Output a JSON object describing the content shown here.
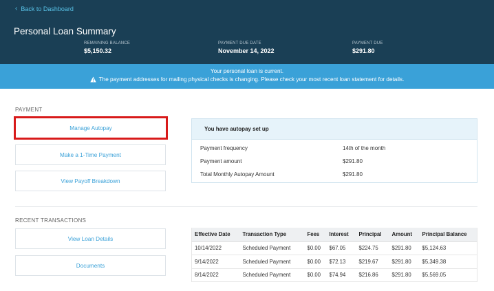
{
  "header": {
    "back_label": "Back to Dashboard",
    "title": "Personal Loan Summary",
    "stats": [
      {
        "label": "REMAINING BALANCE",
        "value": "$5,150.32"
      },
      {
        "label": "PAYMENT DUE DATE",
        "value": "November 14, 2022"
      },
      {
        "label": "PAYMENT DUE",
        "value": "$291.80"
      }
    ]
  },
  "banner": {
    "line1": "Your personal loan is current.",
    "line2": "The payment addresses for mailing physical checks is changing. Please check your most recent loan statement for details."
  },
  "payment": {
    "section_label": "PAYMENT",
    "buttons": [
      "Manage Autopay",
      "Make a 1-Time Payment",
      "View Payoff Breakdown"
    ]
  },
  "autopay": {
    "heading": "You have autopay set up",
    "rows": [
      {
        "label": "Payment frequency",
        "value": "14th of the month"
      },
      {
        "label": "Payment amount",
        "value": "$291.80"
      },
      {
        "label": "Total Monthly Autopay Amount",
        "value": "$291.80"
      }
    ]
  },
  "transactions": {
    "section_label": "RECENT TRANSACTIONS",
    "buttons": [
      "View Loan Details",
      "Documents"
    ],
    "columns": [
      "Effective Date",
      "Transaction Type",
      "Fees",
      "Interest",
      "Principal",
      "Amount",
      "Principal Balance"
    ],
    "rows": [
      [
        "10/14/2022",
        "Scheduled Payment",
        "$0.00",
        "$67.05",
        "$224.75",
        "$291.80",
        "$5,124.63"
      ],
      [
        "9/14/2022",
        "Scheduled Payment",
        "$0.00",
        "$72.13",
        "$219.67",
        "$291.80",
        "$5,349.38"
      ],
      [
        "8/14/2022",
        "Scheduled Payment",
        "$0.00",
        "$74.94",
        "$216.86",
        "$291.80",
        "$5,569.05"
      ]
    ]
  },
  "colors": {
    "header_bg": "#1a3f55",
    "banner_bg": "#3aa1d8",
    "link": "#3aa1d8",
    "highlight": "#d81a1a"
  }
}
